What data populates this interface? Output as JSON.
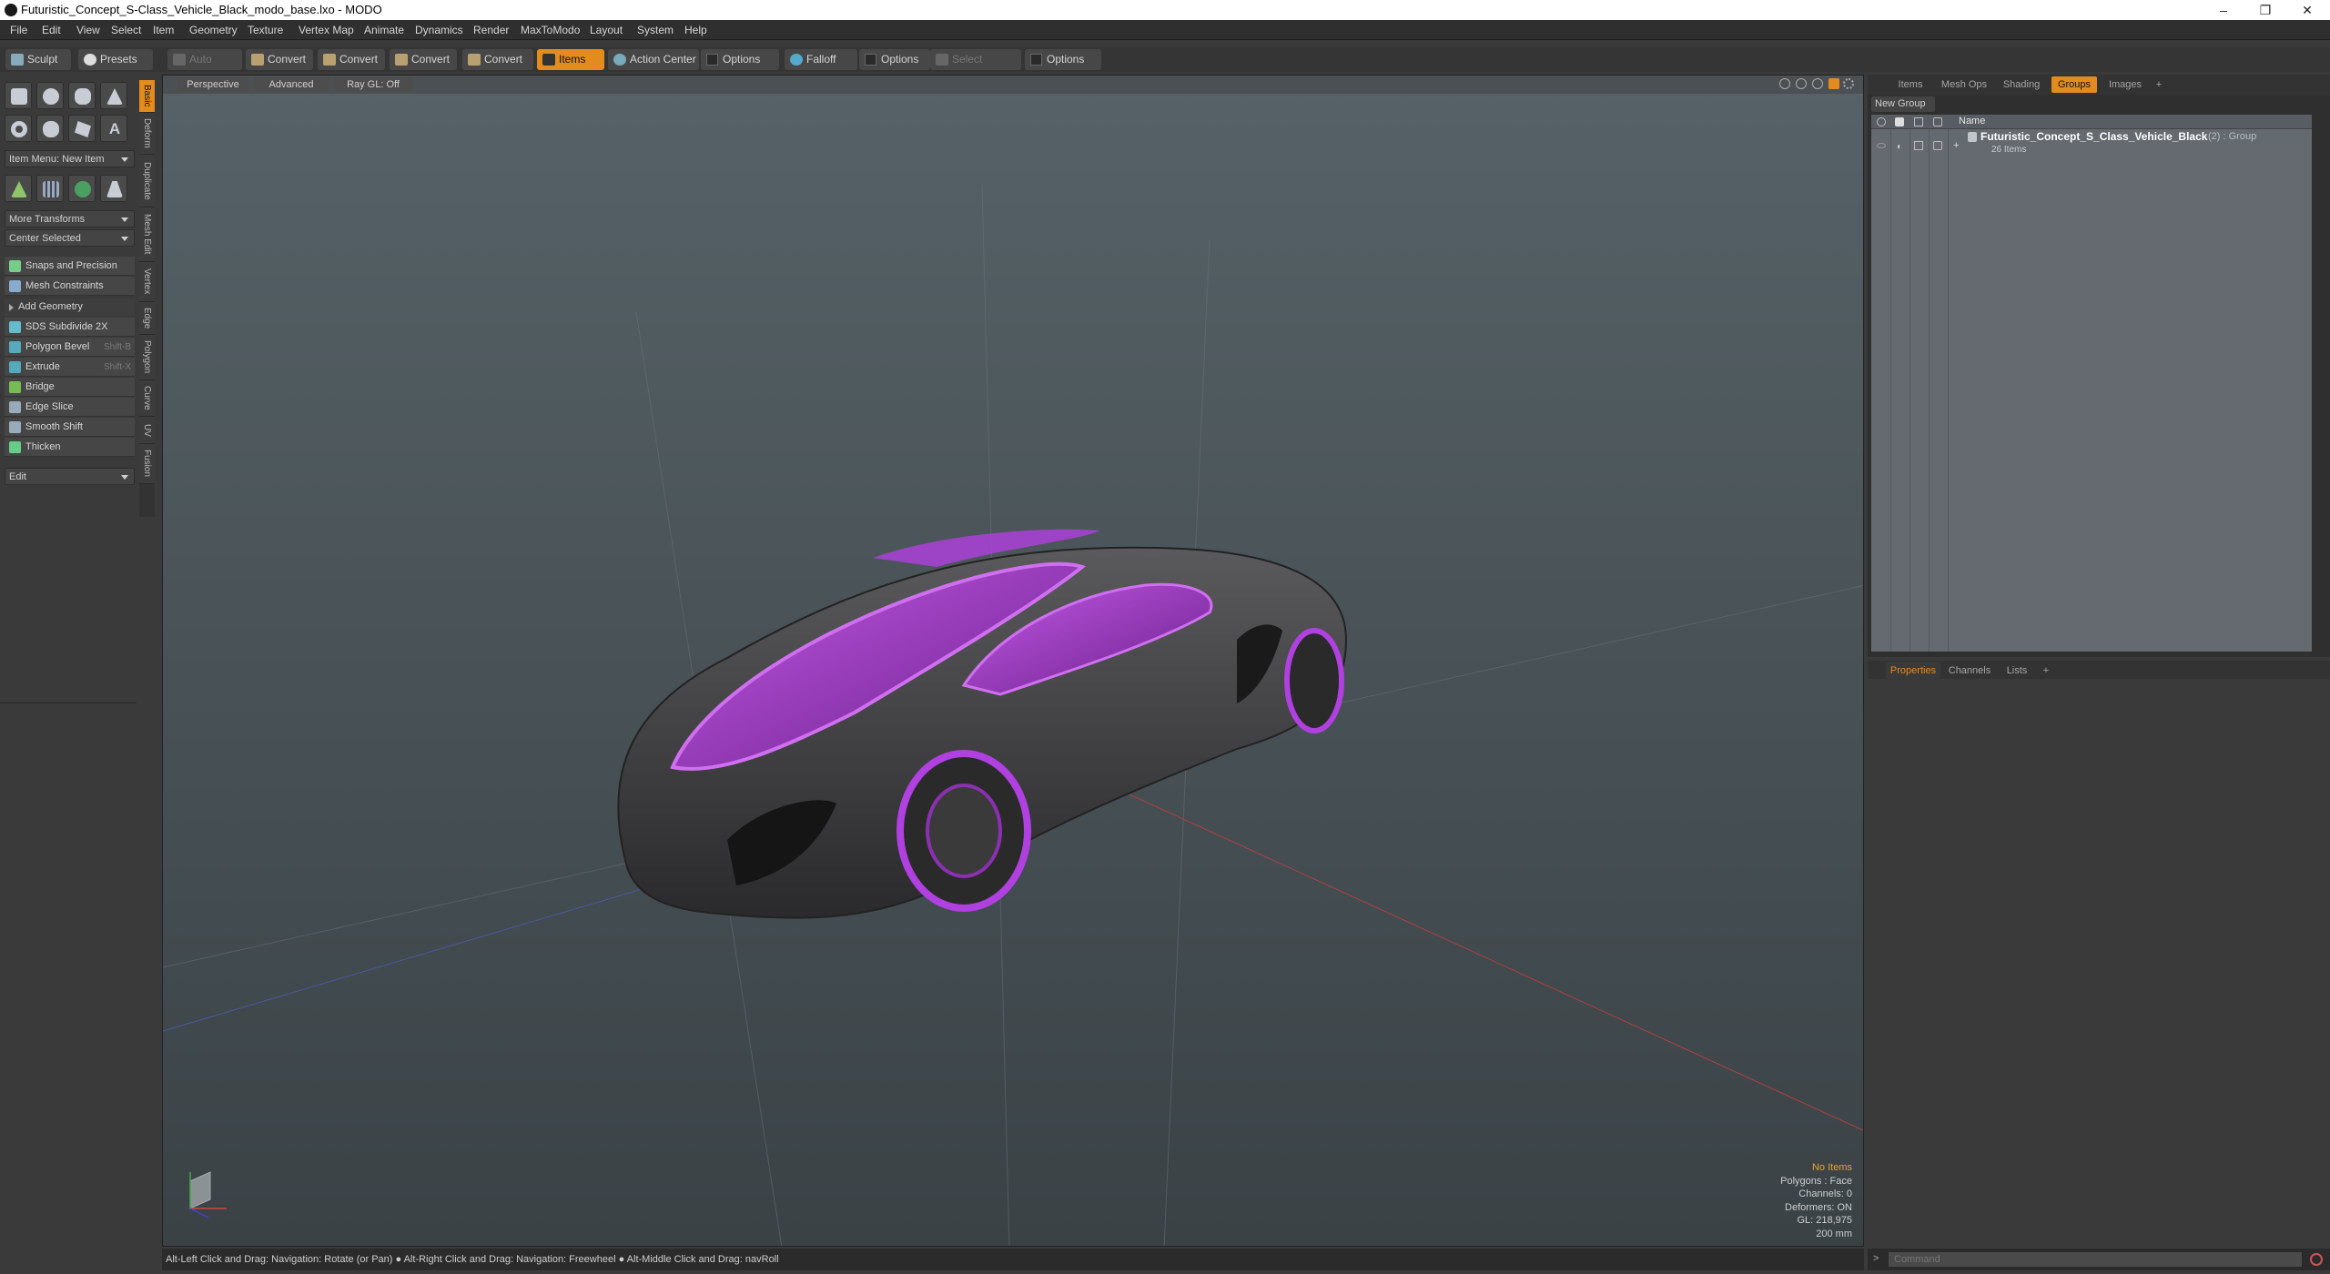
{
  "window": {
    "title": "Futuristic_Concept_S-Class_Vehicle_Black_modo_base.lxo - MODO",
    "controls": [
      "–",
      "❐",
      "✕"
    ]
  },
  "menu": [
    "File",
    "Edit",
    "View",
    "Select",
    "Item",
    "Geometry",
    "Texture",
    "Vertex Map",
    "Animate",
    "Dynamics",
    "Render",
    "MaxToModo",
    "Layout",
    "System",
    "Help"
  ],
  "toolbar": {
    "sculpt": "Sculpt",
    "presets": "Presets",
    "auto_select": "Auto Select",
    "convert1": "Convert",
    "convert2": "Convert",
    "convert3": "Convert",
    "convert4": "Convert",
    "items": "Items",
    "action_center": "Action Center",
    "options1": "Options",
    "falloff": "Falloff",
    "options2": "Options",
    "select_through": "Select Through",
    "options3": "Options"
  },
  "left_panel": {
    "item_menu": "Item Menu: New Item",
    "more_transforms": "More Transforms",
    "center_selected": "Center Selected",
    "snaps": "Snaps and Precision",
    "mesh_constraints": "Mesh Constraints",
    "add_geometry": "Add Geometry",
    "tools": [
      {
        "label": "SDS Subdivide 2X",
        "shortcut": ""
      },
      {
        "label": "Polygon Bevel",
        "shortcut": "Shift-B"
      },
      {
        "label": "Extrude",
        "shortcut": "Shift-X"
      },
      {
        "label": "Bridge",
        "shortcut": ""
      },
      {
        "label": "Edge Slice",
        "shortcut": ""
      },
      {
        "label": "Smooth Shift",
        "shortcut": ""
      },
      {
        "label": "Thicken",
        "shortcut": ""
      }
    ],
    "edit": "Edit"
  },
  "vertical_tabs": [
    "Basic",
    "Deform",
    "Duplicate",
    "Mesh Edit",
    "Vertex",
    "Edge",
    "Polygon",
    "Curve",
    "UV",
    "Fusion"
  ],
  "viewport": {
    "perspective": "Perspective",
    "advanced": "Advanced",
    "raygl": "Ray GL: Off",
    "info": {
      "no_items": "No Items",
      "polygons": "Polygons : Face",
      "channels": "Channels: 0",
      "deformers": "Deformers: ON",
      "gl": "GL: 218,975",
      "scale": "200 mm"
    }
  },
  "status": "Alt-Left Click and Drag: Navigation: Rotate (or Pan) ● Alt-Right Click and Drag: Navigation: Freewheel ● Alt-Middle Click and Drag: navRoll",
  "right_panel": {
    "tabs": [
      "Items",
      "Mesh Ops",
      "Shading",
      "Groups",
      "Images",
      "+"
    ],
    "new_group": "New Group",
    "name_col": "Name",
    "group_name": "Futuristic_Concept_S_Class_Vehicle_Black",
    "group_suffix": "(2) : Group",
    "group_count": "26 Items"
  },
  "props_tabs": [
    "Properties",
    "Channels",
    "Lists",
    "+"
  ],
  "command_placeholder": "Command",
  "colors": {
    "accent": "#e38c1d",
    "car_purple": "#a93bd0"
  }
}
